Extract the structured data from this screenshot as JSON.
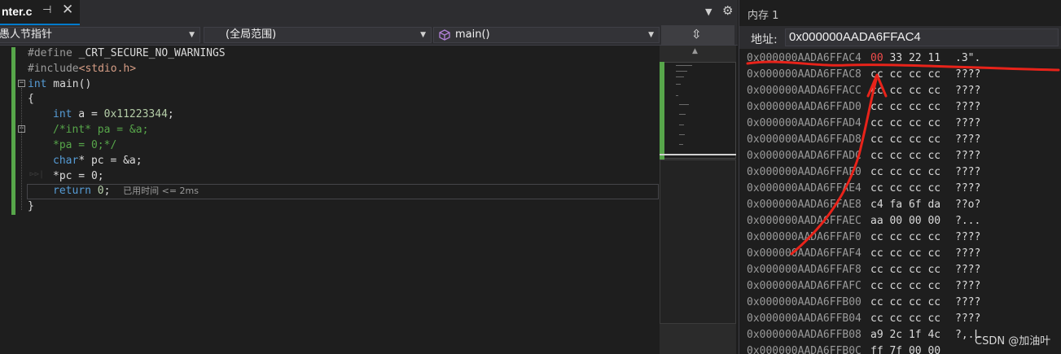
{
  "editor_tab": {
    "title": "nter.c",
    "pin_glyph": "⊣",
    "close_glyph": "✕"
  },
  "navbar": {
    "project": "愚人节指针",
    "scope": "(全局范围)",
    "function": "main()"
  },
  "code": {
    "line1_directive": "#define",
    "line1_macro": " _CRT_SECURE_NO_WARNINGS",
    "line2_directive": "#include",
    "line2_header": "<stdio.h>",
    "line3_kw": "int",
    "line3_rest": " main()",
    "line4": "{",
    "line5_kw": "int",
    "line5_mid": " a = ",
    "line5_num": "0x11223344",
    "line5_end": ";",
    "line6": "/*int* pa = &a;",
    "line7": "*pa = 0;*/",
    "line8_kw": "char",
    "line8_rest": "* pc = &a;",
    "line9": "*pc = 0;",
    "line10_kw": "return",
    "line10_sp": " ",
    "line10_num": "0",
    "line10_end": ";",
    "line10_hint": "已用时间 <= 2ms",
    "line11": "}"
  },
  "memory": {
    "title": "内存 1",
    "addr_label": "地址:",
    "addr_value": "0x000000AADA6FFAC4",
    "rows": [
      {
        "addr": "0x000000AADA6FFAC4",
        "b0": "00",
        "b1": "33",
        "b2": "22",
        "b3": "11",
        "chars": ".3\"."
      },
      {
        "addr": "0x000000AADA6FFAC8",
        "b0": "cc",
        "b1": "cc",
        "b2": "cc",
        "b3": "cc",
        "chars": "????"
      },
      {
        "addr": "0x000000AADA6FFACC",
        "b0": "cc",
        "b1": "cc",
        "b2": "cc",
        "b3": "cc",
        "chars": "????"
      },
      {
        "addr": "0x000000AADA6FFAD0",
        "b0": "cc",
        "b1": "cc",
        "b2": "cc",
        "b3": "cc",
        "chars": "????"
      },
      {
        "addr": "0x000000AADA6FFAD4",
        "b0": "cc",
        "b1": "cc",
        "b2": "cc",
        "b3": "cc",
        "chars": "????"
      },
      {
        "addr": "0x000000AADA6FFAD8",
        "b0": "cc",
        "b1": "cc",
        "b2": "cc",
        "b3": "cc",
        "chars": "????"
      },
      {
        "addr": "0x000000AADA6FFADC",
        "b0": "cc",
        "b1": "cc",
        "b2": "cc",
        "b3": "cc",
        "chars": "????"
      },
      {
        "addr": "0x000000AADA6FFAE0",
        "b0": "cc",
        "b1": "cc",
        "b2": "cc",
        "b3": "cc",
        "chars": "????"
      },
      {
        "addr": "0x000000AADA6FFAE4",
        "b0": "cc",
        "b1": "cc",
        "b2": "cc",
        "b3": "cc",
        "chars": "????"
      },
      {
        "addr": "0x000000AADA6FFAE8",
        "b0": "c4",
        "b1": "fa",
        "b2": "6f",
        "b3": "da",
        "chars": "??o?"
      },
      {
        "addr": "0x000000AADA6FFAEC",
        "b0": "aa",
        "b1": "00",
        "b2": "00",
        "b3": "00",
        "chars": "?..."
      },
      {
        "addr": "0x000000AADA6FFAF0",
        "b0": "cc",
        "b1": "cc",
        "b2": "cc",
        "b3": "cc",
        "chars": "????"
      },
      {
        "addr": "0x000000AADA6FFAF4",
        "b0": "cc",
        "b1": "cc",
        "b2": "cc",
        "b3": "cc",
        "chars": "????"
      },
      {
        "addr": "0x000000AADA6FFAF8",
        "b0": "cc",
        "b1": "cc",
        "b2": "cc",
        "b3": "cc",
        "chars": "????"
      },
      {
        "addr": "0x000000AADA6FFAFC",
        "b0": "cc",
        "b1": "cc",
        "b2": "cc",
        "b3": "cc",
        "chars": "????"
      },
      {
        "addr": "0x000000AADA6FFB00",
        "b0": "cc",
        "b1": "cc",
        "b2": "cc",
        "b3": "cc",
        "chars": "????"
      },
      {
        "addr": "0x000000AADA6FFB04",
        "b0": "cc",
        "b1": "cc",
        "b2": "cc",
        "b3": "cc",
        "chars": "????"
      },
      {
        "addr": "0x000000AADA6FFB08",
        "b0": "a9",
        "b1": "2c",
        "b2": "1f",
        "b3": "4c",
        "chars": "?,.L"
      },
      {
        "addr": "0x000000AADA6FFB0C",
        "b0": "ff",
        "b1": "7f",
        "b2": "00",
        "b3": "00",
        "chars": ""
      }
    ]
  },
  "watermark": "CSDN @加油叶",
  "colors": {
    "accent": "#007acc",
    "changed_byte": "#f14c4c",
    "annotation_ink": "#e8231a",
    "changebar": "#57a64a"
  },
  "icons": {
    "tab_menu": "chevron-down-icon",
    "settings": "gear-icon",
    "split": "split-editor-icon",
    "function_scope": "cube-icon"
  }
}
